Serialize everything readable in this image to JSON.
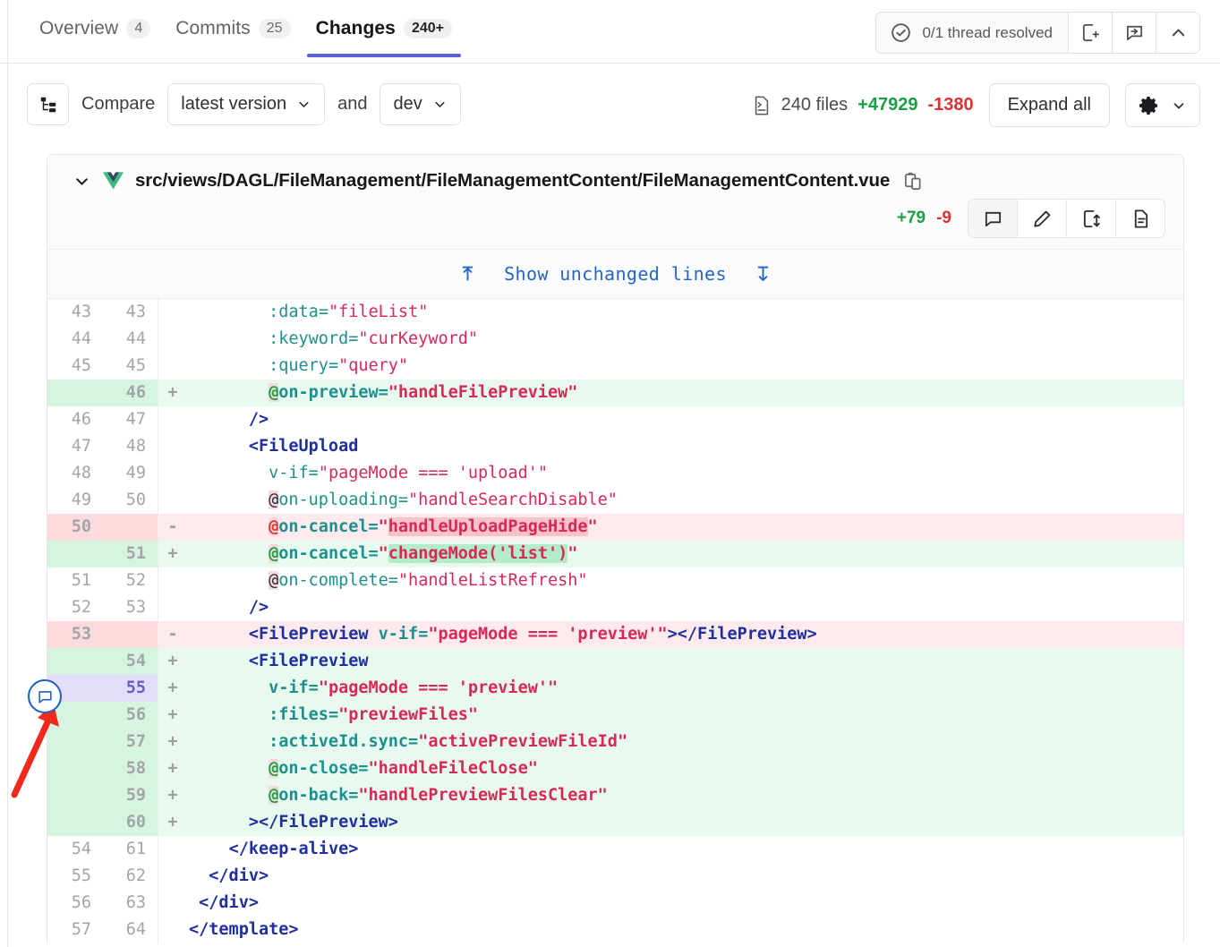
{
  "tabs": [
    {
      "label": "Overview",
      "count": "4",
      "active": false,
      "name": "tab-overview"
    },
    {
      "label": "Commits",
      "count": "25",
      "active": false,
      "name": "tab-commits"
    },
    {
      "label": "Changes",
      "count": "240+",
      "active": true,
      "name": "tab-changes"
    }
  ],
  "header": {
    "thread_status": "0/1 thread resolved",
    "check_icon": "check-circle-icon",
    "add_note_icon": "add-note-icon",
    "jump-comment_icon": "jump-to-comment-icon",
    "collapse_icon": "chevron-up-icon"
  },
  "toolbar": {
    "tree_icon": "file-tree-icon",
    "compare_label": "Compare",
    "version_select": "latest version",
    "and_label": "and",
    "branch_select": "dev",
    "files_icon": "file-diff-icon",
    "files_count": "240 files",
    "additions": "+47929",
    "deletions": "-1380",
    "expand_all": "Expand all",
    "gear_icon": "gear-icon",
    "chevron_icon": "chevron-down-icon"
  },
  "file": {
    "caret_icon": "chevron-down-icon",
    "type_icon": "vue-file-icon",
    "path": "src/views/DAGL/FileManagement/FileManagementContent/FileManagementContent.vue",
    "copy_icon": "copy-path-icon",
    "additions": "+79",
    "deletions": "-9",
    "actions": [
      {
        "name": "comment-icon",
        "title": "comment"
      },
      {
        "name": "edit-pencil-icon",
        "title": "edit"
      },
      {
        "name": "view-file-icon",
        "title": "view file"
      },
      {
        "name": "file-detail-icon",
        "title": "file detail"
      }
    ]
  },
  "expander": {
    "up_icon": "expand-up-icon",
    "label": "Show unchanged lines",
    "down_icon": "expand-down-icon"
  },
  "diff_lines": [
    {
      "old": "43",
      "new": "43",
      "sign": "",
      "type": "ctx",
      "tokens": [
        {
          "t": "        ",
          "c": ""
        },
        {
          "t": ":data",
          "c": "attr"
        },
        {
          "t": "=",
          "c": "eq"
        },
        {
          "t": "\"fileList\"",
          "c": "str"
        }
      ]
    },
    {
      "old": "44",
      "new": "44",
      "sign": "",
      "type": "ctx",
      "tokens": [
        {
          "t": "        ",
          "c": ""
        },
        {
          "t": ":keyword",
          "c": "attr"
        },
        {
          "t": "=",
          "c": "eq"
        },
        {
          "t": "\"curKeyword\"",
          "c": "str"
        }
      ]
    },
    {
      "old": "45",
      "new": "45",
      "sign": "",
      "type": "ctx",
      "tokens": [
        {
          "t": "        ",
          "c": ""
        },
        {
          "t": ":query",
          "c": "attr"
        },
        {
          "t": "=",
          "c": "eq"
        },
        {
          "t": "\"query\"",
          "c": "str"
        }
      ]
    },
    {
      "old": "",
      "new": "46",
      "sign": "+",
      "type": "add",
      "tokens": [
        {
          "t": "        ",
          "c": ""
        },
        {
          "t": "@",
          "c": "at"
        },
        {
          "t": "on-preview",
          "c": "attr"
        },
        {
          "t": "=",
          "c": "eq"
        },
        {
          "t": "\"handleFilePreview\"",
          "c": "str"
        }
      ]
    },
    {
      "old": "46",
      "new": "47",
      "sign": "",
      "type": "ctx",
      "tokens": [
        {
          "t": "      ",
          "c": ""
        },
        {
          "t": "/>",
          "c": "tag"
        }
      ]
    },
    {
      "old": "47",
      "new": "48",
      "sign": "",
      "type": "ctx",
      "tokens": [
        {
          "t": "      ",
          "c": ""
        },
        {
          "t": "<FileUpload",
          "c": "tag"
        }
      ]
    },
    {
      "old": "48",
      "new": "49",
      "sign": "",
      "type": "ctx",
      "tokens": [
        {
          "t": "        ",
          "c": ""
        },
        {
          "t": "v-if",
          "c": "attr"
        },
        {
          "t": "=",
          "c": "eq"
        },
        {
          "t": "\"pageMode === 'upload'\"",
          "c": "str"
        }
      ]
    },
    {
      "old": "49",
      "new": "50",
      "sign": "",
      "type": "ctx",
      "tokens": [
        {
          "t": "        ",
          "c": ""
        },
        {
          "t": "@",
          "c": "at"
        },
        {
          "t": "on-uploading",
          "c": "attr"
        },
        {
          "t": "=",
          "c": "eq"
        },
        {
          "t": "\"handleSearchDisable\"",
          "c": "str"
        }
      ]
    },
    {
      "old": "50",
      "new": "",
      "sign": "-",
      "type": "del",
      "tokens": [
        {
          "t": "        ",
          "c": ""
        },
        {
          "t": "@",
          "c": "at"
        },
        {
          "t": "on-cancel",
          "c": "attr"
        },
        {
          "t": "=",
          "c": "eq"
        },
        {
          "t": "\"",
          "c": "str"
        },
        {
          "t": "handleUploadPageHide",
          "c": "str wdel"
        },
        {
          "t": "\"",
          "c": "str"
        }
      ]
    },
    {
      "old": "",
      "new": "51",
      "sign": "+",
      "type": "add",
      "tokens": [
        {
          "t": "        ",
          "c": ""
        },
        {
          "t": "@",
          "c": "at"
        },
        {
          "t": "on-cancel",
          "c": "attr"
        },
        {
          "t": "=",
          "c": "eq"
        },
        {
          "t": "\"",
          "c": "str"
        },
        {
          "t": "changeMode('list')",
          "c": "str wadd"
        },
        {
          "t": "\"",
          "c": "str"
        }
      ]
    },
    {
      "old": "51",
      "new": "52",
      "sign": "",
      "type": "ctx",
      "tokens": [
        {
          "t": "        ",
          "c": ""
        },
        {
          "t": "@",
          "c": "at"
        },
        {
          "t": "on-complete",
          "c": "attr"
        },
        {
          "t": "=",
          "c": "eq"
        },
        {
          "t": "\"handleListRefresh\"",
          "c": "str"
        }
      ]
    },
    {
      "old": "52",
      "new": "53",
      "sign": "",
      "type": "ctx",
      "tokens": [
        {
          "t": "      ",
          "c": ""
        },
        {
          "t": "/>",
          "c": "tag"
        }
      ]
    },
    {
      "old": "53",
      "new": "",
      "sign": "-",
      "type": "del",
      "tokens": [
        {
          "t": "      ",
          "c": ""
        },
        {
          "t": "<FilePreview ",
          "c": "tag"
        },
        {
          "t": "v-if",
          "c": "attr"
        },
        {
          "t": "=",
          "c": "eq"
        },
        {
          "t": "\"pageMode === 'preview'\"",
          "c": "str"
        },
        {
          "t": "></FilePreview>",
          "c": "tag"
        }
      ]
    },
    {
      "old": "",
      "new": "54",
      "sign": "+",
      "type": "add",
      "tokens": [
        {
          "t": "      ",
          "c": ""
        },
        {
          "t": "<FilePreview",
          "c": "tag"
        }
      ]
    },
    {
      "old": "",
      "new": "55",
      "sign": "+",
      "type": "add",
      "commented": true,
      "tokens": [
        {
          "t": "        ",
          "c": ""
        },
        {
          "t": "v-if",
          "c": "attr"
        },
        {
          "t": "=",
          "c": "eq"
        },
        {
          "t": "\"pageMode === 'preview'\"",
          "c": "str"
        }
      ]
    },
    {
      "old": "",
      "new": "56",
      "sign": "+",
      "type": "add",
      "tokens": [
        {
          "t": "        ",
          "c": ""
        },
        {
          "t": ":files",
          "c": "attr"
        },
        {
          "t": "=",
          "c": "eq"
        },
        {
          "t": "\"previewFiles\"",
          "c": "str"
        }
      ]
    },
    {
      "old": "",
      "new": "57",
      "sign": "+",
      "type": "add",
      "tokens": [
        {
          "t": "        ",
          "c": ""
        },
        {
          "t": ":activeId.sync",
          "c": "attr"
        },
        {
          "t": "=",
          "c": "eq"
        },
        {
          "t": "\"activePreviewFileId\"",
          "c": "str"
        }
      ]
    },
    {
      "old": "",
      "new": "58",
      "sign": "+",
      "type": "add",
      "tokens": [
        {
          "t": "        ",
          "c": ""
        },
        {
          "t": "@",
          "c": "at"
        },
        {
          "t": "on-close",
          "c": "attr"
        },
        {
          "t": "=",
          "c": "eq"
        },
        {
          "t": "\"handleFileClose\"",
          "c": "str"
        }
      ]
    },
    {
      "old": "",
      "new": "59",
      "sign": "+",
      "type": "add",
      "tokens": [
        {
          "t": "        ",
          "c": ""
        },
        {
          "t": "@",
          "c": "at"
        },
        {
          "t": "on-back",
          "c": "attr"
        },
        {
          "t": "=",
          "c": "eq"
        },
        {
          "t": "\"handlePreviewFilesClear\"",
          "c": "str"
        }
      ]
    },
    {
      "old": "",
      "new": "60",
      "sign": "+",
      "type": "add",
      "tokens": [
        {
          "t": "      ",
          "c": ""
        },
        {
          "t": "></FilePreview>",
          "c": "tag"
        }
      ]
    },
    {
      "old": "54",
      "new": "61",
      "sign": "",
      "type": "ctx",
      "tokens": [
        {
          "t": "    ",
          "c": ""
        },
        {
          "t": "</keep-alive>",
          "c": "tag"
        }
      ]
    },
    {
      "old": "55",
      "new": "62",
      "sign": "",
      "type": "ctx",
      "tokens": [
        {
          "t": "  ",
          "c": ""
        },
        {
          "t": "</div>",
          "c": "tag"
        }
      ]
    },
    {
      "old": "56",
      "new": "63",
      "sign": "",
      "type": "ctx",
      "tokens": [
        {
          "t": " ",
          "c": ""
        },
        {
          "t": "</div>",
          "c": "tag"
        }
      ]
    },
    {
      "old": "57",
      "new": "64",
      "sign": "",
      "type": "ctx",
      "tokens": [
        {
          "t": "",
          "c": ""
        },
        {
          "t": "</template>",
          "c": "tag"
        }
      ]
    }
  ],
  "annotation": {
    "comment_marker_icon": "comment-bubble-icon",
    "pointer_icon": "red-arrow-annotation"
  },
  "colors": {
    "accent": "#5c62d4",
    "addition": "#1a9f45",
    "deletion": "#e03131",
    "link": "#2566c4",
    "comment_marker": "#1e5fc0",
    "annotation_arrow": "#f2281c"
  }
}
